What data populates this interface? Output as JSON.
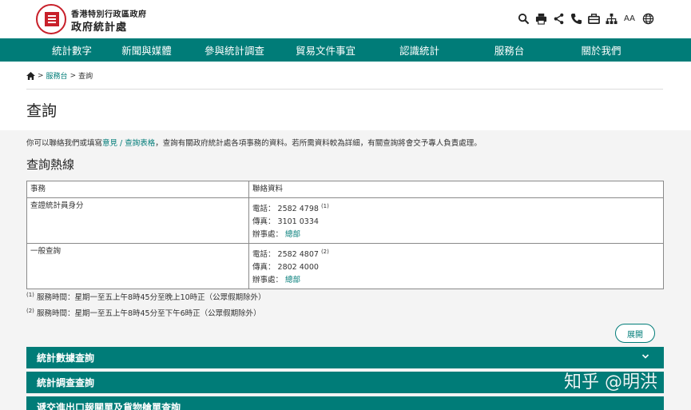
{
  "header": {
    "org_line1": "香港特別行政區政府",
    "org_line2": "政府統計處",
    "logo_icon": "census-dept-logo",
    "tools": [
      "search-icon",
      "print-icon",
      "share-icon",
      "phone-icon",
      "briefcase-icon",
      "sitemap-icon",
      "font-size-icon",
      "globe-icon"
    ],
    "font_size_label": "AA"
  },
  "nav": {
    "items": [
      "統計數字",
      "新聞與媒體",
      "參與統計調查",
      "貿易文件事宜",
      "認識統計",
      "服務台",
      "關於我們"
    ]
  },
  "breadcrumb": {
    "sep1": ">",
    "item1": "服務台",
    "sep2": ">",
    "current": "查詢"
  },
  "page_title": "查詢",
  "intro": {
    "before": "你可以聯絡我們或填寫",
    "link": "意見 / 查詢表格",
    "after": "，查詢有關政府統計處各項事務的資料。若所需資料較為詳細，有關查詢將會交予專人負責處理。"
  },
  "section_title": "查詢熱線",
  "table": {
    "headers": [
      "事務",
      "聯絡資料"
    ],
    "rows": [
      {
        "task": "查證統計員身分",
        "phone_label": "電話：",
        "phone": "2582 4798",
        "phone_note": "(1)",
        "fax_label": "傳真：",
        "fax": "3101 0334",
        "office_label": "辦事處：",
        "office": "總部"
      },
      {
        "task": "一般查詢",
        "phone_label": "電話：",
        "phone": "2582 4807",
        "phone_note": "(2)",
        "fax_label": "傳真：",
        "fax": "2802 4000",
        "office_label": "辦事處：",
        "office": "總部"
      }
    ]
  },
  "notes": [
    {
      "mark": "(1)",
      "text": "服務時間：星期一至五上午8時45分至晚上10時正（公眾假期除外）"
    },
    {
      "mark": "(2)",
      "text": "服務時間：星期一至五上午8時45分至下午6時正（公眾假期除外）"
    }
  ],
  "expand_label": "展開",
  "accordions": [
    "統計數據查詢",
    "統計調查查詢",
    "遞交進出口報關單及貨物艙單查詢"
  ],
  "watermark": "知乎 @明洪",
  "colors": {
    "brand": "#007c78",
    "logo_red": "#c8202a"
  }
}
